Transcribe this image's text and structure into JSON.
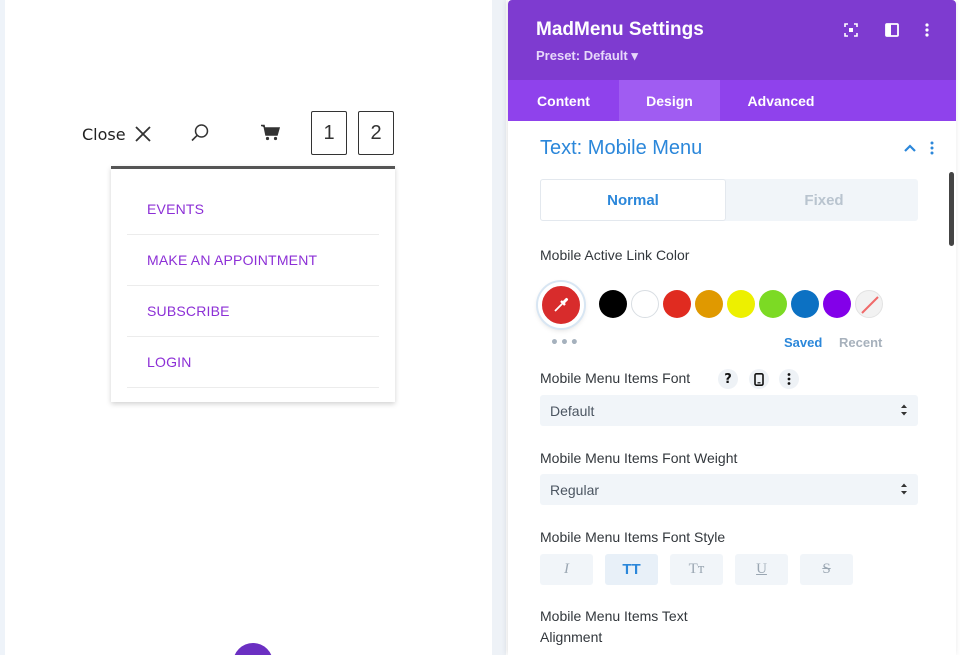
{
  "preview": {
    "close_label": "Close",
    "box_labels": [
      "1",
      "2"
    ],
    "menu_items": [
      {
        "label": "EVENTS"
      },
      {
        "label": "MAKE AN APPOINTMENT"
      },
      {
        "label": "SUBSCRIBE"
      },
      {
        "label": "LOGIN"
      }
    ],
    "link_color": "#8c2fd6"
  },
  "panel": {
    "title": "MadMenu Settings",
    "preset": "Preset: Default ▾",
    "tabs": [
      {
        "label": "Content",
        "active": false
      },
      {
        "label": "Design",
        "active": true
      },
      {
        "label": "Advanced",
        "active": false
      }
    ],
    "section_title": "Text: Mobile Menu",
    "state_toggle": {
      "normal": "Normal",
      "fixed": "Fixed",
      "selected": "Normal"
    },
    "active_link_color_label": "Mobile Active Link Color",
    "current_color": "#d82c2c",
    "swatches": [
      "#000000",
      "#ffffff",
      "#e02b20",
      "#e09900",
      "#edf000",
      "#7cda24",
      "#0c71c3",
      "#8300e9",
      "none"
    ],
    "saved_label": "Saved",
    "recent_label": "Recent",
    "font_label": "Mobile Menu Items Font",
    "help_symbol": "?",
    "font_value": "Default",
    "weight_label": "Mobile Menu Items Font Weight",
    "weight_value": "Regular",
    "style_label": "Mobile Menu Items Font Style",
    "style_buttons": [
      {
        "text": "I",
        "active": false
      },
      {
        "text": "TT",
        "active": true
      },
      {
        "text": "Tт",
        "active": false
      },
      {
        "text": "U",
        "active": false
      },
      {
        "text": "S",
        "active": false
      }
    ],
    "alignment_label_line1": "Mobile Menu Items Text",
    "alignment_label_line2": "Alignment"
  },
  "colors": {
    "header_purple": "#7e3bd0",
    "tab_purple": "#8f42ec",
    "accent_blue": "#2b87da"
  }
}
